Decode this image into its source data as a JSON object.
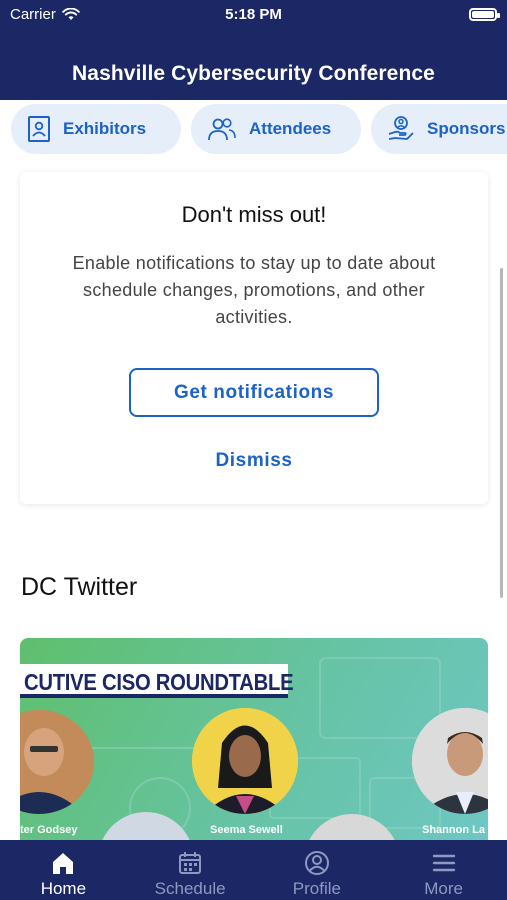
{
  "status_bar": {
    "carrier": "Carrier",
    "time": "5:18 PM"
  },
  "header": {
    "title": "Nashville Cybersecurity Conference"
  },
  "quick_links": [
    {
      "label": "Exhibitors",
      "icon": "badge-icon"
    },
    {
      "label": "Attendees",
      "icon": "people-icon"
    },
    {
      "label": "Sponsors",
      "icon": "hand-person-icon"
    }
  ],
  "notification_card": {
    "title": "Don't miss out!",
    "description": "Enable notifications to stay up to date about schedule changes, promotions, and other activities.",
    "primary_button": "Get notifications",
    "secondary_button": "Dismiss"
  },
  "twitter_section": {
    "title": "DC Twitter",
    "banner_text": "CUTIVE CISO ROUNDTABLE",
    "names": [
      "ter Godsey",
      "Seema Sewell",
      "Shannon La"
    ]
  },
  "tabbar": {
    "items": [
      {
        "label": "Home",
        "icon": "home-icon",
        "active": true
      },
      {
        "label": "Schedule",
        "icon": "calendar-icon",
        "active": false
      },
      {
        "label": "Profile",
        "icon": "profile-icon",
        "active": false
      },
      {
        "label": "More",
        "icon": "menu-icon",
        "active": false
      }
    ]
  },
  "colors": {
    "brand": "#1c2766",
    "accent": "#1c62c8",
    "pill_bg": "#e6eefa"
  }
}
